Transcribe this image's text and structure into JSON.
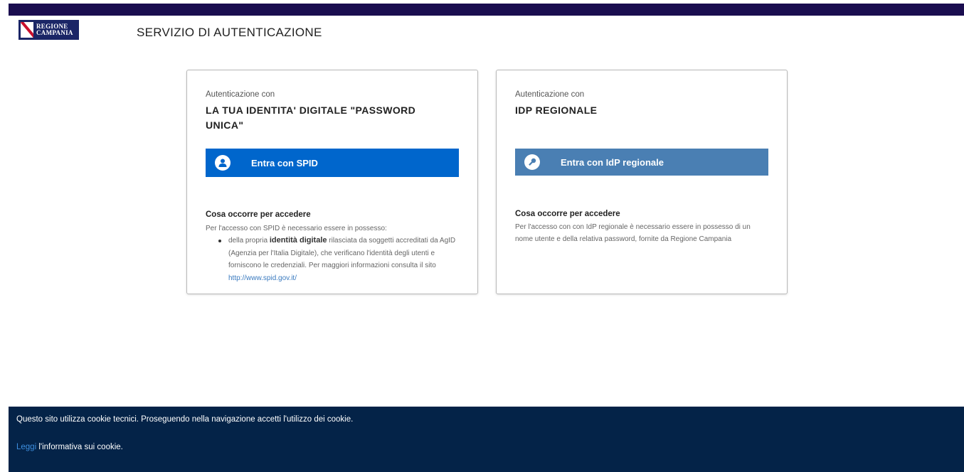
{
  "header": {
    "logo_line1": "REGIONE",
    "logo_line2": "CAMPANIA",
    "title": "SERVIZIO DI AUTENTICAZIONE"
  },
  "spid_card": {
    "kicker": "Autenticazione con",
    "heading": "LA TUA IDENTITA' DIGITALE \"PASSWORD UNICA\"",
    "button_label": "Entra con SPID",
    "button_color": "#0066cc",
    "req_title": "Cosa occorre per accedere",
    "req_text": "Per l'accesso con SPID è necessario essere in possesso:",
    "list_item": {
      "prefix": "della propria ",
      "bold": "identità digitale",
      "suffix": " rilasciata da soggetti accreditati da AgID (Agenzia per l'Italia Digitale), che verificano l'identità degli utenti e forniscono le credenziali. Per maggiori informazioni consulta il sito ",
      "link": "http://www.spid.gov.it/"
    }
  },
  "idp_card": {
    "kicker": "Autenticazione con",
    "heading": "IDP REGIONALE",
    "button_label": "Entra con IdP regionale",
    "button_color": "#4a7fb3",
    "req_title": "Cosa occorre per accedere",
    "req_text": "Per l'accesso con con IdP regionale è necessario essere in possesso di un nome utente e della relativa password, fornite da Regione Campania"
  },
  "cookie_bar": {
    "text": "Questo sito utilizza cookie tecnici. Proseguendo nella navigazione accetti l'utilizzo dei cookie.",
    "link": "Leggi",
    "link_suffix": " l'informativa sui cookie."
  },
  "colors": {
    "top_bar": "#1a0d4f",
    "cookie_bar": "#042348"
  }
}
